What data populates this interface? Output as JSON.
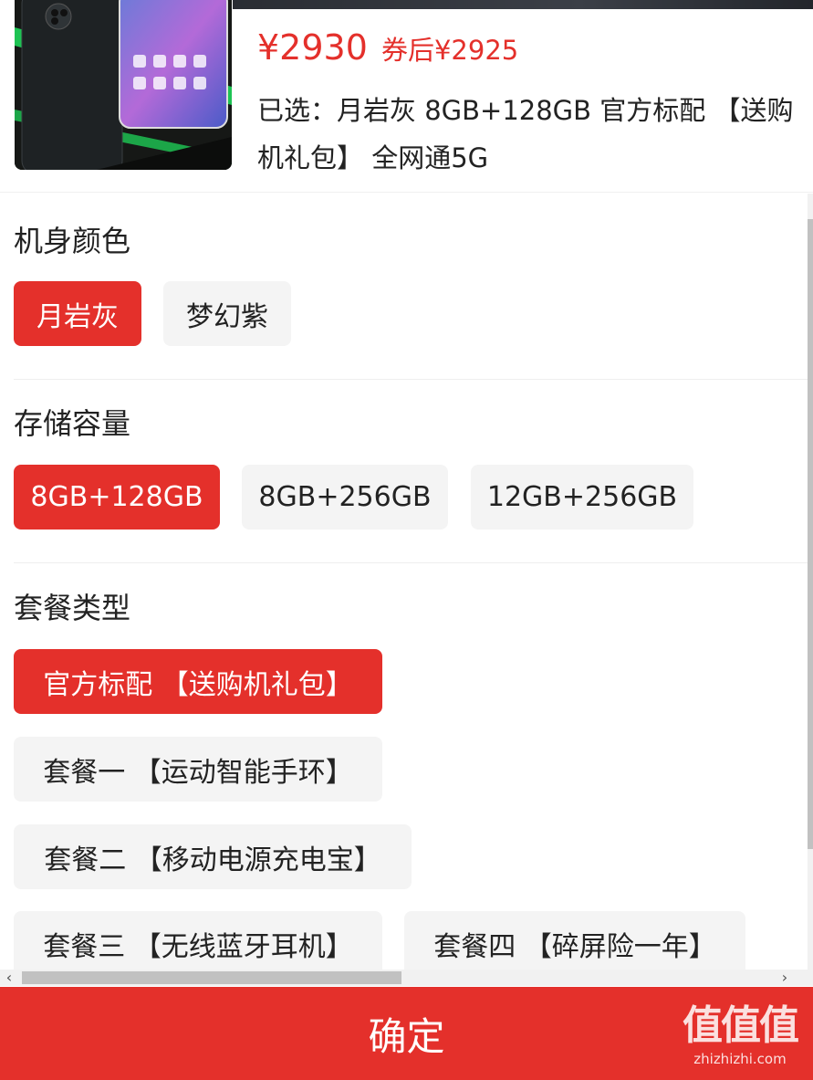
{
  "product": {
    "price": "¥2930",
    "coupon_price": "券后¥2925",
    "selected": "已选：月岩灰 8GB+128GB 官方标配 【送购机礼包】 全网通5G"
  },
  "sections": {
    "color": {
      "title": "机身颜色",
      "options": [
        {
          "label": "月岩灰",
          "selected": true
        },
        {
          "label": "梦幻紫",
          "selected": false
        }
      ]
    },
    "storage": {
      "title": "存储容量",
      "options": [
        {
          "label": "8GB+128GB",
          "selected": true
        },
        {
          "label": "8GB+256GB",
          "selected": false
        },
        {
          "label": "12GB+256GB",
          "selected": false
        }
      ]
    },
    "package": {
      "title": "套餐类型",
      "options": [
        {
          "label": "官方标配 【送购机礼包】",
          "selected": true
        },
        {
          "label": "套餐一 【运动智能手环】",
          "selected": false
        },
        {
          "label": "套餐二 【移动电源充电宝】",
          "selected": false
        },
        {
          "label": "套餐三 【无线蓝牙耳机】",
          "selected": false
        },
        {
          "label": "套餐四 【碎屏险一年】",
          "selected": false
        }
      ]
    }
  },
  "scrollbar": {
    "left_arrow": "‹",
    "right_arrow": "›"
  },
  "confirm_label": "确定",
  "watermark": {
    "logo": "值值值",
    "url": "zhizhizhi.com"
  },
  "colors": {
    "accent": "#e4302b",
    "chip_bg": "#f4f4f4",
    "text": "#222222"
  }
}
